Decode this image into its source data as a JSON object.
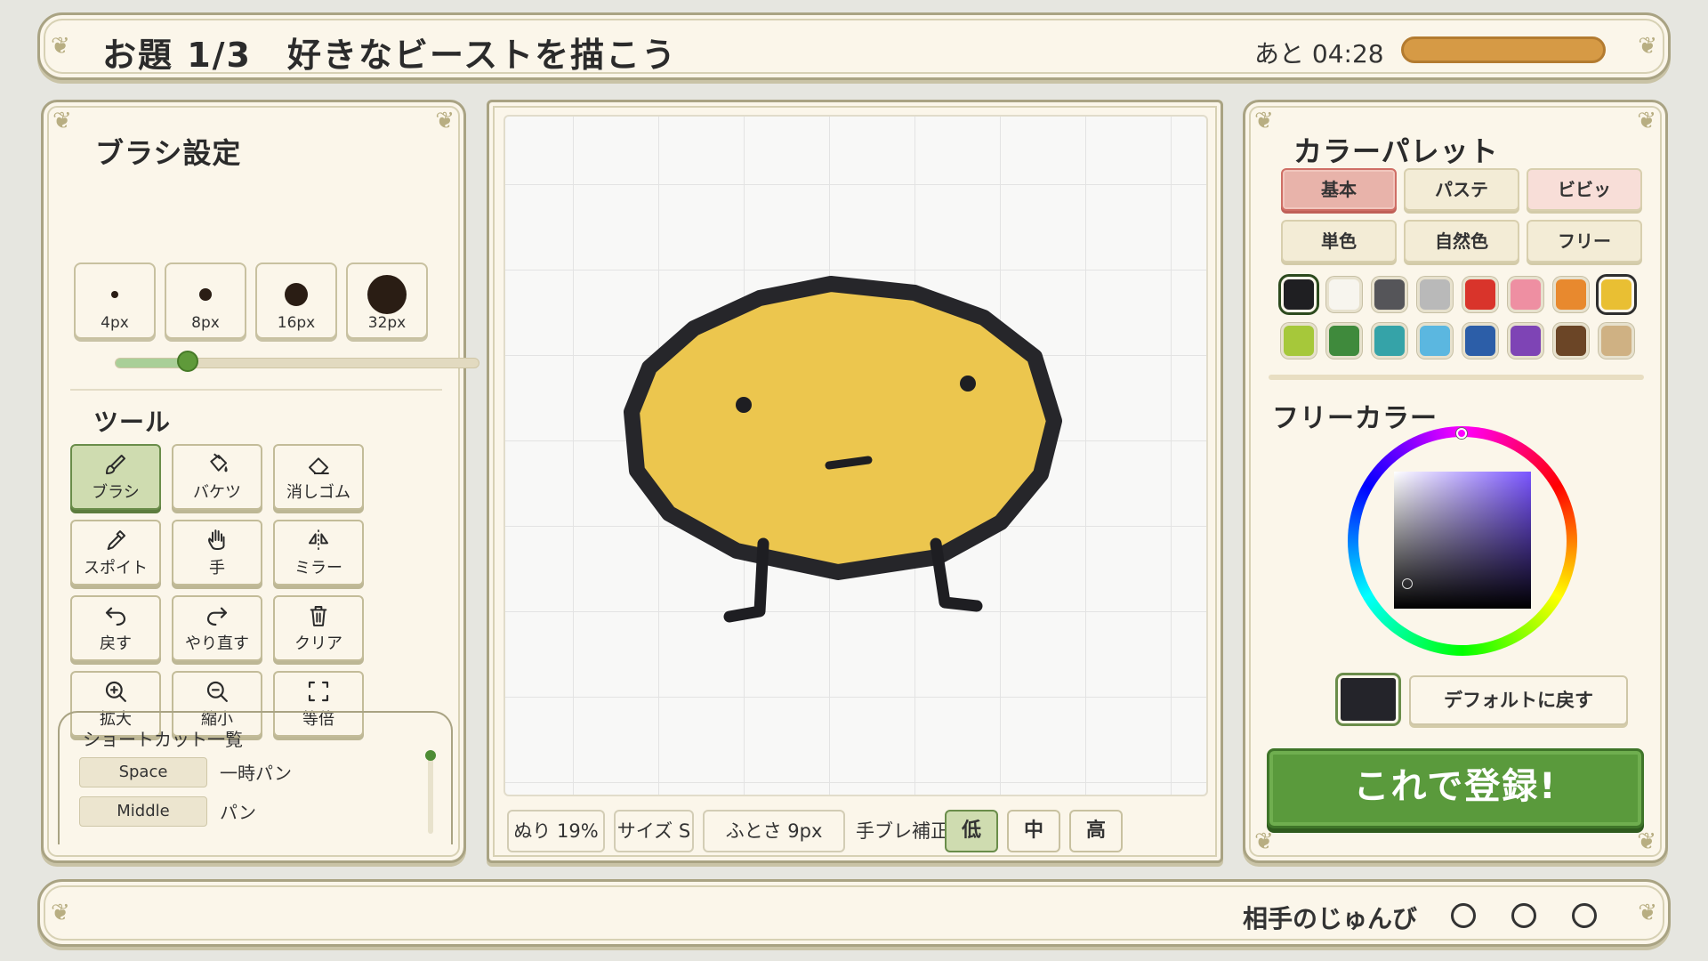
{
  "header": {
    "prompt_title": "お題 1/3　好きなビーストを描こう",
    "timer_label": "あと 04:28",
    "timer_fraction": 1.0
  },
  "brush_settings": {
    "title": "ブラシ設定",
    "sizes": [
      "4px",
      "8px",
      "16px",
      "32px"
    ],
    "slider_fraction": 0.2
  },
  "tools": {
    "title": "ツール",
    "items": [
      {
        "label": "ブラシ",
        "icon": "brush-icon",
        "active": true
      },
      {
        "label": "バケツ",
        "icon": "bucket-icon"
      },
      {
        "label": "消しゴム",
        "icon": "eraser-icon"
      },
      {
        "label": "スポイト",
        "icon": "eyedropper-icon"
      },
      {
        "label": "手",
        "icon": "hand-icon"
      },
      {
        "label": "ミラー",
        "icon": "mirror-icon"
      },
      {
        "label": "戻す",
        "icon": "undo-icon"
      },
      {
        "label": "やり直す",
        "icon": "redo-icon"
      },
      {
        "label": "クリア",
        "icon": "trash-icon"
      },
      {
        "label": "拡大",
        "icon": "zoom-in-icon"
      },
      {
        "label": "縮小",
        "icon": "zoom-out-icon"
      },
      {
        "label": "等倍",
        "icon": "fit-icon"
      }
    ]
  },
  "shortcuts": {
    "title": "ショートカット一覧",
    "items": [
      {
        "key": "Space",
        "desc": "一時パン"
      },
      {
        "key": "Middle",
        "desc": "パン"
      }
    ]
  },
  "canvas_status": {
    "fill": "ぬり 19%",
    "size": "サイズ S",
    "thickness": "ふとさ 9px",
    "stabilizer_label": "手ブレ補正",
    "stabilizer_options": [
      "低",
      "中",
      "高"
    ],
    "stabilizer_selected": "低"
  },
  "palette": {
    "title": "カラーパレット",
    "tabs": [
      "基本",
      "パステ",
      "ビビッ",
      "単色",
      "自然色",
      "フリー"
    ],
    "active_tab": "基本",
    "colors": [
      "#1f1f22",
      "#f7f5ee",
      "#555559",
      "#b9b9b9",
      "#d9342b",
      "#ee8fa2",
      "#e8892e",
      "#e9bf33",
      "#a6c83a",
      "#3f8a3c",
      "#35a3a8",
      "#5bb7e0",
      "#2c5ea8",
      "#7e44b5",
      "#6b4526",
      "#cfb183"
    ],
    "selected_colors": [
      "#1f1f22",
      "#e9bf33"
    ]
  },
  "free_color": {
    "title": "フリーカラー",
    "current": "#24242a",
    "reset_label": "デフォルトに戻す"
  },
  "submit": {
    "label": "これで登録!"
  },
  "footer": {
    "ready_label": "相手のじゅんび",
    "ready_count": 3
  }
}
